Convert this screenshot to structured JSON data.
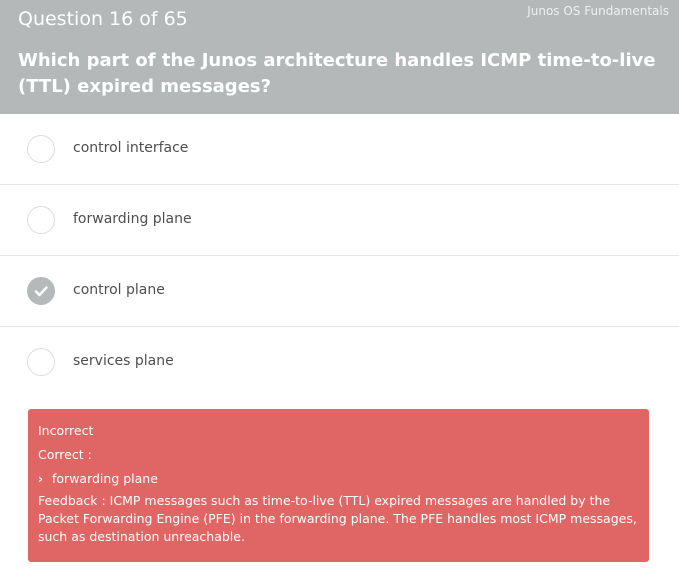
{
  "header": {
    "question_counter": "Question 16 of 65",
    "course_name": "Junos OS Fundamentals",
    "question_text": "Which part of the Junos architecture handles ICMP time-to-live (TTL) expired messages?"
  },
  "options": [
    {
      "label": "control interface",
      "selected": false
    },
    {
      "label": "forwarding plane",
      "selected": false
    },
    {
      "label": "control plane",
      "selected": true
    },
    {
      "label": "services plane",
      "selected": false
    }
  ],
  "feedback": {
    "status": "Incorrect",
    "correct_label": "Correct :",
    "correct_answer": "forwarding plane",
    "feedback_text": "Feedback : ICMP messages such as time-to-live (TTL) expired messages are handled by the Packet Forwarding Engine (PFE) in the forwarding plane. The PFE handles most ICMP messages, such as destination unreachable.",
    "color": "#e06666"
  },
  "colors": {
    "header_bg": "#b4b8b9",
    "selected_radio": "#b6b9ba"
  }
}
